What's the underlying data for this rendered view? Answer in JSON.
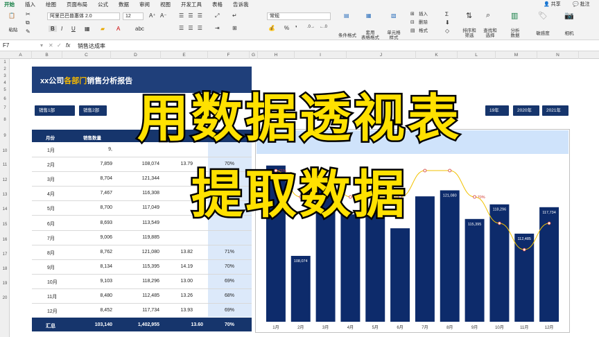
{
  "tabs": [
    "开始",
    "插入",
    "绘图",
    "页面布局",
    "公式",
    "数据",
    "审阅",
    "视图",
    "开发工具",
    "表格",
    "告诉我"
  ],
  "active_tab": "开始",
  "ribbon": {
    "paste": "粘贴",
    "font_name": "阿里巴巴普惠体 2.0",
    "font_size": "12",
    "number_format": "常规",
    "cond_format": "条件格式",
    "table_format": "套用\n表格格式",
    "cell_style": "单元格\n样式",
    "insert": "插入",
    "delete": "删除",
    "format": "格式",
    "sort_filter": "排序和\n筛选",
    "find_select": "查找和\n选择",
    "analyze": "分析\n数据",
    "sensitivity": "敏感度",
    "camera": "相机",
    "share": "共享",
    "comment": "批注"
  },
  "formula_bar": {
    "cell_ref": "F7",
    "fx": "fx",
    "content": "销售达成率"
  },
  "columns": [
    "A",
    "B",
    "C",
    "D",
    "E",
    "F",
    "G",
    "H",
    "I",
    "J",
    "K",
    "L",
    "M",
    "N"
  ],
  "rows": [
    "1",
    "2",
    "3",
    "4",
    "5",
    "6",
    "7",
    "8",
    "9",
    "10",
    "11",
    "12",
    "13",
    "14",
    "15",
    "16",
    "17",
    "18",
    "19",
    "20"
  ],
  "report": {
    "title_prefix": "xx公司",
    "title_highlight": "各部门",
    "title_suffix": "销售分析报告"
  },
  "filters_left": [
    "销售1部",
    "销售2部"
  ],
  "filters_right": [
    "20",
    "19年",
    "2020年",
    "2021年"
  ],
  "table": {
    "headers": [
      "月份",
      "销售数量"
    ],
    "rows": [
      {
        "month": "1月",
        "qty": "9,",
        "amt": "",
        "price": "",
        "pct": ""
      },
      {
        "month": "2月",
        "qty": "7,859",
        "amt": "108,074",
        "price": "13.79",
        "pct": "70%"
      },
      {
        "month": "3月",
        "qty": "8,704",
        "amt": "121,344",
        "price": "",
        "pct": ""
      },
      {
        "month": "4月",
        "qty": "7,467",
        "amt": "116,308",
        "price": "",
        "pct": ""
      },
      {
        "month": "5月",
        "qty": "8,700",
        "amt": "117,049",
        "price": "",
        "pct": ""
      },
      {
        "month": "6月",
        "qty": "8,693",
        "amt": "113,549",
        "price": "",
        "pct": ""
      },
      {
        "month": "7月",
        "qty": "9,006",
        "amt": "119,885",
        "price": "",
        "pct": ""
      },
      {
        "month": "8月",
        "qty": "8,762",
        "amt": "121,080",
        "price": "13.82",
        "pct": "71%"
      },
      {
        "month": "9月",
        "qty": "8,134",
        "amt": "115,395",
        "price": "14.19",
        "pct": "70%"
      },
      {
        "month": "10月",
        "qty": "9,103",
        "amt": "118,296",
        "price": "13.00",
        "pct": "69%"
      },
      {
        "month": "11月",
        "qty": "8,480",
        "amt": "112,485",
        "price": "13.26",
        "pct": "68%"
      },
      {
        "month": "12月",
        "qty": "8,452",
        "amt": "117,734",
        "price": "13.93",
        "pct": "69%"
      }
    ],
    "total": {
      "label": "汇总",
      "qty": "103,140",
      "amt": "1,402,955",
      "price": "13.60",
      "pct": "70%"
    }
  },
  "chart_data": {
    "type": "bar",
    "categories": [
      "1月",
      "2月",
      "3月",
      "4月",
      "5月",
      "6月",
      "7月",
      "8月",
      "9月",
      "10月",
      "11月",
      "12月"
    ],
    "series": [
      {
        "values": [
          126000,
          108074,
          121344,
          116308,
          117049,
          113549,
          119885,
          121080,
          115395,
          118296,
          112485,
          117734
        ]
      },
      {
        "values": [
          71,
          70,
          71,
          70,
          70,
          70,
          71,
          71,
          70,
          69,
          68,
          69
        ]
      }
    ],
    "bar_labels": [
      "",
      "108,074",
      "",
      "",
      "",
      "",
      "",
      "121,080",
      "115,395",
      "118,296",
      "112,485",
      "117,734"
    ],
    "line_labels": [
      "71%",
      "",
      "",
      "",
      "",
      "",
      "",
      "",
      "70%",
      "",
      "",
      ""
    ],
    "bar_color": "#0d2b6b",
    "line_color": "#f2c200",
    "ylim": [
      95000,
      125000
    ]
  },
  "overlay": {
    "line1": "用数据透视表",
    "line2": "提取数据"
  }
}
